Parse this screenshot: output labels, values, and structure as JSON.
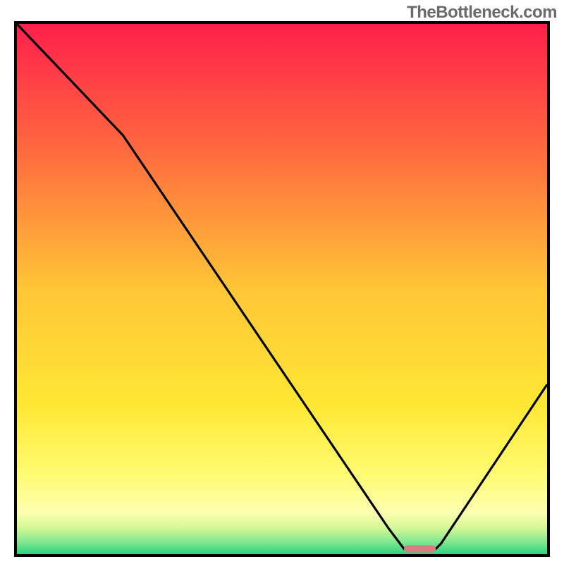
{
  "watermark": "TheBottleneck.com",
  "chart_data": {
    "type": "line",
    "xlim": [
      0,
      100
    ],
    "ylim": [
      0,
      100
    ],
    "series": [
      {
        "name": "bottleneck-curve",
        "x": [
          0,
          20,
          70,
          73,
          79,
          80,
          100
        ],
        "y": [
          100,
          79,
          5,
          1,
          1,
          2,
          32
        ]
      }
    ],
    "marker": {
      "name": "optimal-range",
      "x_start": 73,
      "x_end": 79,
      "y": 1,
      "color": "#dc7b80"
    },
    "background_gradient": {
      "stops": [
        {
          "offset": 0.0,
          "color": "#ff1f4b"
        },
        {
          "offset": 0.25,
          "color": "#ff6e3e"
        },
        {
          "offset": 0.5,
          "color": "#ffc636"
        },
        {
          "offset": 0.72,
          "color": "#ffe834"
        },
        {
          "offset": 0.85,
          "color": "#fffc73"
        },
        {
          "offset": 0.92,
          "color": "#fdffb0"
        },
        {
          "offset": 0.95,
          "color": "#d6f896"
        },
        {
          "offset": 0.975,
          "color": "#88e890"
        },
        {
          "offset": 1.0,
          "color": "#2bd481"
        }
      ]
    },
    "title": "",
    "xlabel": "",
    "ylabel": ""
  }
}
